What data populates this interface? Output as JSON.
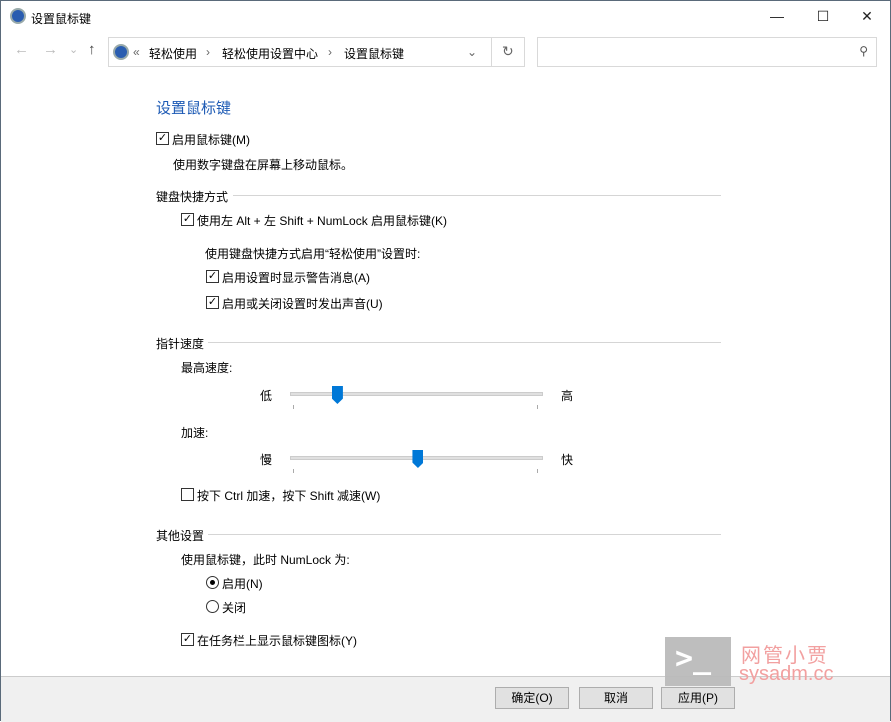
{
  "window": {
    "title": "设置鼠标键",
    "minimize": "—",
    "maximize": "☐",
    "close": "✕"
  },
  "nav": {
    "back": "←",
    "forward": "→",
    "recent": "⌄",
    "up": "↑",
    "breadcrumb_overflow": "«",
    "breadcrumb": [
      "轻松使用",
      "轻松使用设置中心",
      "设置鼠标键"
    ],
    "sep": "›",
    "dropdown": "⌄",
    "refresh": "↻",
    "search_placeholder": "",
    "search_icon": "⚲"
  },
  "main": {
    "heading": "设置鼠标键",
    "enable_mousekeys": {
      "label": "启用鼠标键(M)",
      "checked": true
    },
    "enable_desc": "使用数字键盘在屏幕上移动鼠标。",
    "shortcut_group": "键盘快捷方式",
    "shortcut_enable": {
      "label": "使用左 Alt + 左 Shift + NumLock 启用鼠标键(K)",
      "checked": true
    },
    "shortcut_sub": "使用键盘快捷方式启用“轻松使用”设置时:",
    "warn": {
      "label": "启用设置时显示警告消息(A)",
      "checked": true
    },
    "sound": {
      "label": "启用或关闭设置时发出声音(U)",
      "checked": true
    },
    "speed_group": "指针速度",
    "top_speed": {
      "label": "最高速度:",
      "low": "低",
      "high": "高",
      "value_percent": 18
    },
    "accel": {
      "label": "加速:",
      "low": "慢",
      "high": "快",
      "value_percent": 51
    },
    "ctrl_shift": {
      "label": "按下 Ctrl 加速，按下 Shift 减速(W)",
      "checked": false
    },
    "other_group": "其他设置",
    "numlock_label": "使用鼠标键，此时 NumLock 为:",
    "radio_on": {
      "label": "启用(N)",
      "selected": true
    },
    "radio_off": {
      "label": "关闭",
      "selected": false
    },
    "taskbar_icon": {
      "label": "在任务栏上显示鼠标键图标(Y)",
      "checked": true
    }
  },
  "buttons": {
    "ok": "确定(O)",
    "cancel": "取消",
    "apply": "应用(P)"
  },
  "watermark": {
    "name": "网管小贾",
    "site": "sysadm.cc"
  }
}
